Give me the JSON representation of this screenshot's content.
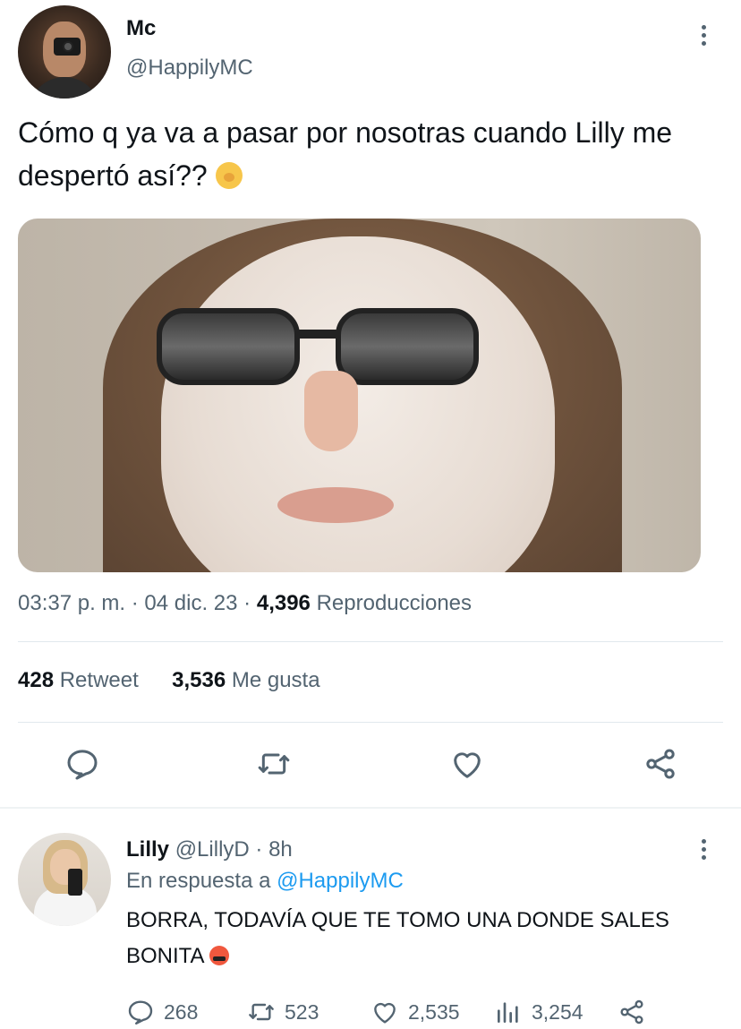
{
  "tweet": {
    "author_name": "Mc",
    "author_handle": "@HappilyMC",
    "text": "Cómo q ya va a pasar por nosotras cuando Lilly me despertó así??",
    "time": "03:37 p. m.",
    "date": "04 dic. 23",
    "views": "4,396",
    "views_label": "Reproducciones",
    "retweets": "428",
    "retweets_label": "Retweet",
    "likes": "3,536",
    "likes_label": "Me gusta",
    "emoji": "yawning-face-emoji"
  },
  "reply": {
    "author_name": "Lilly",
    "author_handle": "@LillyD",
    "age": "8h",
    "reply_to_label": "En respuesta a",
    "reply_to_handle": "@HappilyMC",
    "text": "BORRA, TODAVÍA QUE TE TOMO UNA DONDE SALES BONITA",
    "emoji": "face-with-symbols-emoji",
    "counts": {
      "replies": "268",
      "retweets": "523",
      "likes": "2,535",
      "views": "3,254"
    }
  },
  "separator": "·",
  "colors": {
    "text": "#0f1419",
    "secondary": "#536471",
    "link": "#1d9bf0",
    "divider": "#e1e8ed"
  }
}
